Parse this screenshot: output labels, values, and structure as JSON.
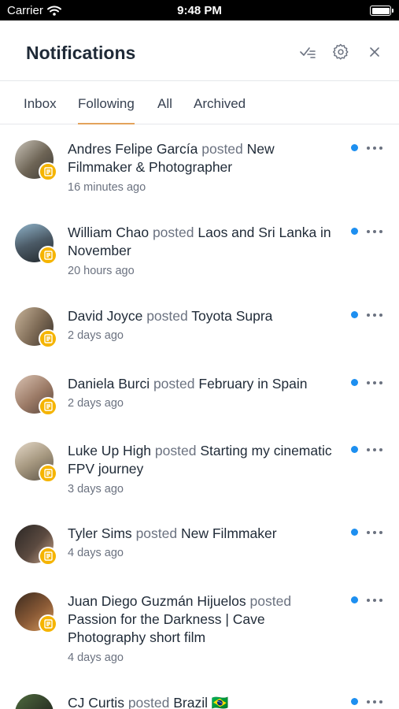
{
  "status_bar": {
    "carrier": "Carrier",
    "time": "9:48 PM"
  },
  "header": {
    "title": "Notifications"
  },
  "tabs": [
    {
      "label": "Inbox",
      "active": false
    },
    {
      "label": "Following",
      "active": true
    },
    {
      "label": "All",
      "active": false
    },
    {
      "label": "Archived",
      "active": false
    }
  ],
  "notifications": [
    {
      "author": "Andres Felipe García",
      "verb": "posted",
      "title": "New Filmmaker & Photographer",
      "ago": "16 minutes ago",
      "unread": true
    },
    {
      "author": "William Chao",
      "verb": "posted",
      "title": "Laos and Sri Lanka in November",
      "ago": "20 hours ago",
      "unread": true
    },
    {
      "author": "David Joyce",
      "verb": "posted",
      "title": "Toyota Supra",
      "ago": "2 days ago",
      "unread": true
    },
    {
      "author": "Daniela Burci",
      "verb": "posted",
      "title": "February in Spain",
      "ago": "2 days ago",
      "unread": true
    },
    {
      "author": "Luke Up High",
      "verb": "posted",
      "title": "Starting my cinematic FPV journey",
      "ago": "3 days ago",
      "unread": true
    },
    {
      "author": "Tyler Sims",
      "verb": "posted",
      "title": "New Filmmaker",
      "ago": "4 days ago",
      "unread": true
    },
    {
      "author": "Juan Diego Guzmán Hijuelos",
      "verb": "posted",
      "title": "Passion for the Darkness | Cave Photography short film",
      "ago": "4 days ago",
      "unread": true
    },
    {
      "author": "CJ Curtis",
      "verb": "posted",
      "title": "Brazil 🇧🇷",
      "ago": "",
      "unread": true
    }
  ],
  "colors": {
    "accent_underline": "#e3a35c",
    "unread_dot": "#1d8ff0",
    "badge": "#f5b400"
  }
}
